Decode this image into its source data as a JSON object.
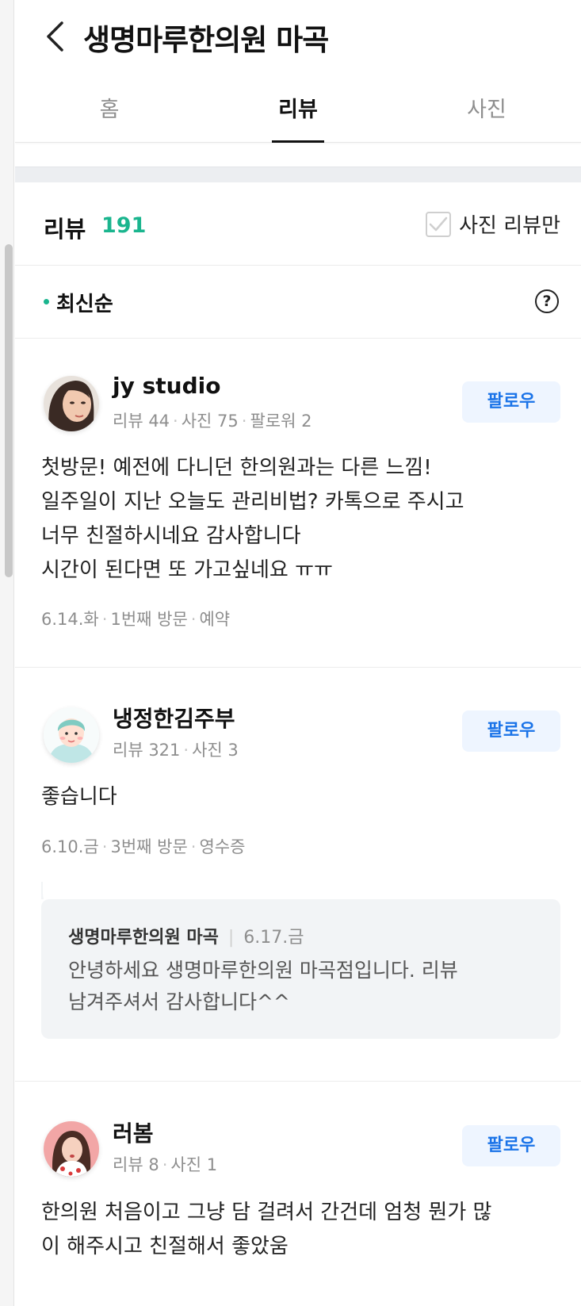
{
  "header": {
    "title": "생명마루한의원 마곡",
    "tabs": [
      {
        "label": "홈",
        "active": false
      },
      {
        "label": "리뷰",
        "active": true
      },
      {
        "label": "사진",
        "active": false
      }
    ]
  },
  "review_summary": {
    "title": "리뷰",
    "count": "191",
    "photo_filter_label": "사진 리뷰만",
    "sort_label": "최신순",
    "help_label": "?"
  },
  "colors": {
    "accent_green": "#1ab58e",
    "follow_blue": "#1a73e8",
    "follow_bg": "#eef5ff"
  },
  "reviews": [
    {
      "user": "jy studio",
      "meta": [
        "리뷰 44",
        "사진 75",
        "팔로워 2"
      ],
      "follow_label": "팔로우",
      "avatar": "woman-face-illustration-avatar",
      "lines": [
        "첫방문! 예전에 다니던 한의원과는 다른 느낌!",
        "일주일이 지난 오늘도 관리비법? 카톡으로 주시고",
        "너무 친절하시네요 감사합니다",
        "시간이 된다면 또 가고싶네요 ㅠㅠ"
      ],
      "visit": [
        "6.14.화",
        "1번째 방문",
        "예약"
      ]
    },
    {
      "user": "냉정한김주부",
      "meta": [
        "리뷰 321",
        "사진 3"
      ],
      "follow_label": "팔로우",
      "avatar": "cartoon-person-avatar",
      "lines": [
        "좋습니다"
      ],
      "visit": [
        "6.10.금",
        "3번째 방문",
        "영수증"
      ],
      "reply": {
        "owner": "생명마루한의원 마곡",
        "date": "6.17.금",
        "lines": [
          "안녕하세요 생명마루한의원 마곡점입니다. 리뷰",
          "남겨주셔서 감사합니다^^"
        ]
      }
    },
    {
      "user": "러봄",
      "meta": [
        "리뷰 8",
        "사진 1"
      ],
      "follow_label": "팔로우",
      "avatar": "woman-photo-avatar",
      "lines": [
        "한의원 처음이고 그냥 담 걸려서 간건데 엄청 뭔가 많",
        "이 해주시고 친절해서 좋았움"
      ]
    }
  ]
}
